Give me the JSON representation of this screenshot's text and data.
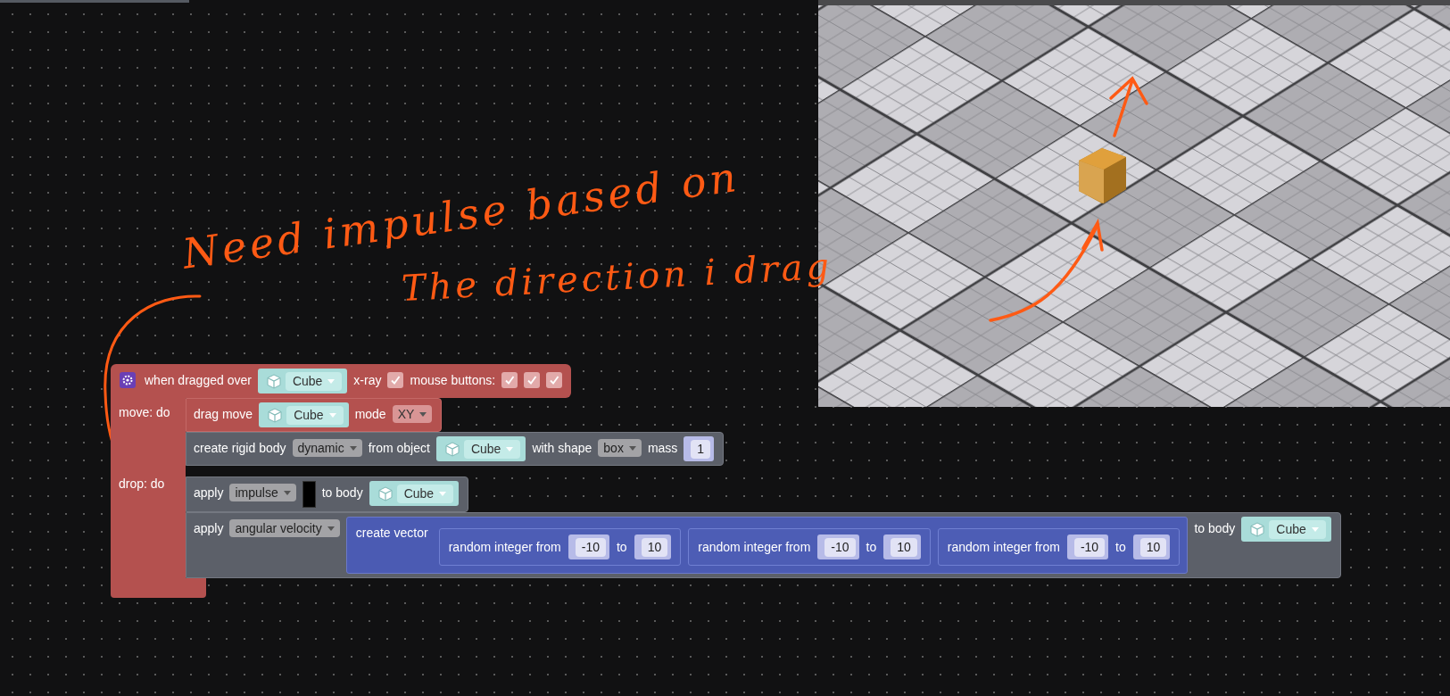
{
  "annotation": {
    "lines": [
      "Need impulse based on",
      "The direction i drag"
    ]
  },
  "event_block": {
    "parts": [
      {
        "kind": "text",
        "text": "when dragged over"
      },
      {
        "kind": "object",
        "value": "Cube"
      },
      {
        "kind": "text",
        "text": "x-ray"
      },
      {
        "kind": "checkbox",
        "checked": true
      },
      {
        "kind": "text",
        "text": "mouse buttons:"
      },
      {
        "kind": "checkbox",
        "checked": true
      },
      {
        "kind": "checkbox",
        "checked": true
      },
      {
        "kind": "checkbox",
        "checked": true
      }
    ],
    "sections": [
      {
        "label": "move: do",
        "statements": [
          {
            "kind": "event",
            "parts": [
              {
                "kind": "text",
                "text": "drag move"
              },
              {
                "kind": "object",
                "value": "Cube"
              },
              {
                "kind": "text",
                "text": "mode"
              },
              {
                "kind": "dropdown",
                "value": "XY"
              }
            ]
          },
          {
            "kind": "physics",
            "parts": [
              {
                "kind": "text",
                "text": "create rigid body"
              },
              {
                "kind": "dropdown",
                "value": "dynamic"
              },
              {
                "kind": "text",
                "text": "from object"
              },
              {
                "kind": "object",
                "value": "Cube"
              },
              {
                "kind": "text",
                "text": "with shape"
              },
              {
                "kind": "dropdown",
                "value": "box"
              },
              {
                "kind": "text",
                "text": "mass"
              },
              {
                "kind": "number",
                "value": "1"
              }
            ]
          }
        ]
      },
      {
        "label": "drop: do",
        "statements": [
          {
            "kind": "physics",
            "parts": [
              {
                "kind": "text",
                "text": "apply"
              },
              {
                "kind": "dropdown",
                "value": "impulse"
              },
              {
                "kind": "slot"
              },
              {
                "kind": "text",
                "text": "to body"
              },
              {
                "kind": "object",
                "value": "Cube"
              }
            ]
          },
          {
            "kind": "physics",
            "parts": [
              {
                "kind": "text",
                "text": "apply"
              },
              {
                "kind": "dropdown",
                "value": "angular velocity"
              },
              {
                "kind": "vector",
                "parts": [
                  {
                    "kind": "text",
                    "text": "create vector"
                  },
                  {
                    "kind": "random_integer",
                    "parts": [
                      {
                        "kind": "text",
                        "text": "random integer from"
                      },
                      {
                        "kind": "number",
                        "value": "-10"
                      },
                      {
                        "kind": "text",
                        "text": "to"
                      },
                      {
                        "kind": "number",
                        "value": "10"
                      }
                    ]
                  },
                  {
                    "kind": "random_integer",
                    "parts": [
                      {
                        "kind": "text",
                        "text": "random integer from"
                      },
                      {
                        "kind": "number",
                        "value": "-10"
                      },
                      {
                        "kind": "text",
                        "text": "to"
                      },
                      {
                        "kind": "number",
                        "value": "10"
                      }
                    ]
                  },
                  {
                    "kind": "random_integer",
                    "parts": [
                      {
                        "kind": "text",
                        "text": "random integer from"
                      },
                      {
                        "kind": "number",
                        "value": "-10"
                      },
                      {
                        "kind": "text",
                        "text": "to"
                      },
                      {
                        "kind": "number",
                        "value": "10"
                      }
                    ]
                  }
                ]
              },
              {
                "kind": "text",
                "text": "to body"
              },
              {
                "kind": "object",
                "value": "Cube"
              }
            ]
          }
        ]
      }
    ]
  }
}
